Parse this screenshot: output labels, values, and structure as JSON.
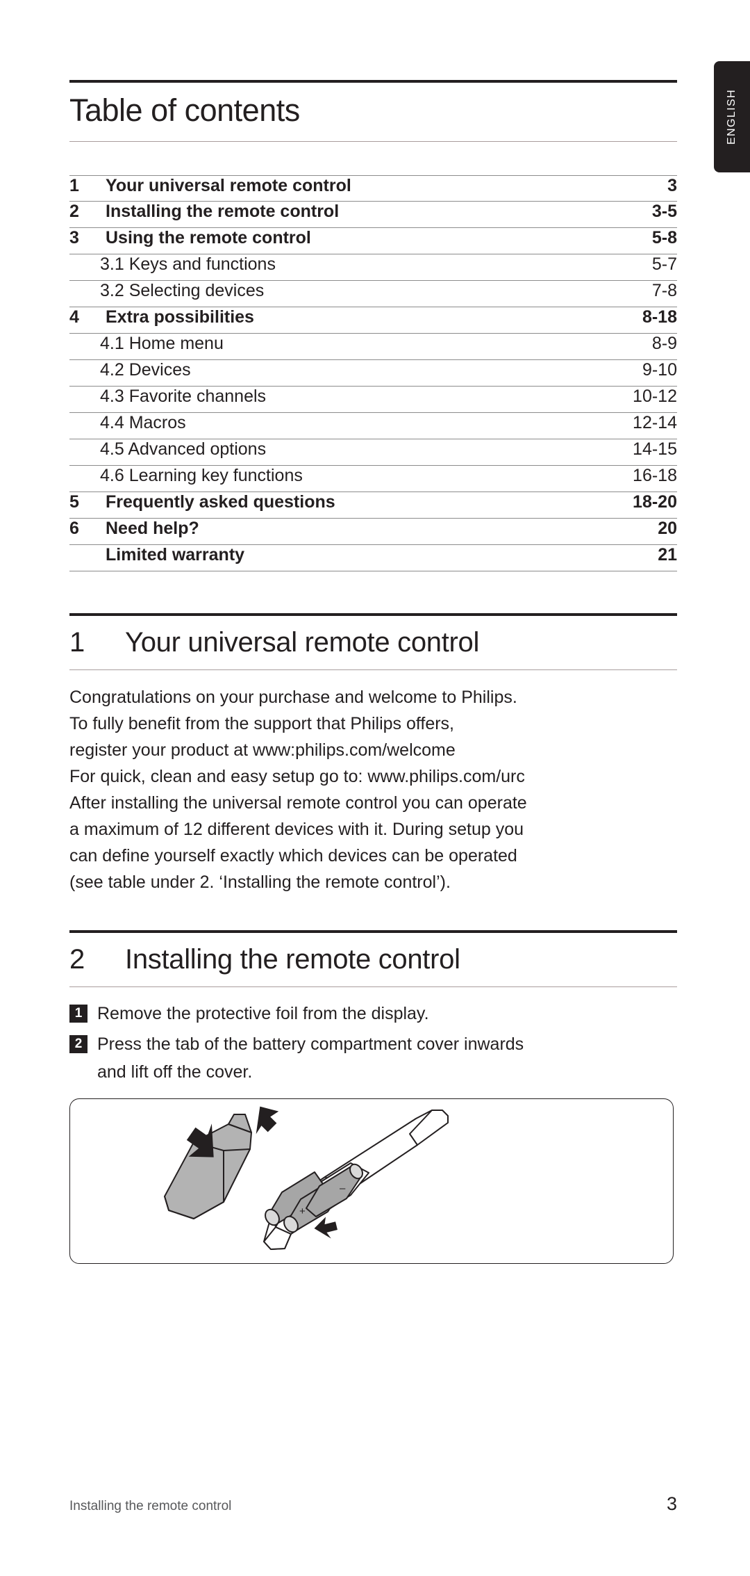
{
  "side_tab": {
    "label": "ENGLISH"
  },
  "toc": {
    "title": "Table of contents",
    "rows": [
      {
        "level": 1,
        "num": "1",
        "label": "Your universal remote control",
        "page": "3"
      },
      {
        "level": 1,
        "num": "2",
        "label": "Installing the remote control",
        "page": "3-5"
      },
      {
        "level": 1,
        "num": "3",
        "label": "Using the remote control",
        "page": "5-8"
      },
      {
        "level": 2,
        "num": "",
        "label": "3.1 Keys and functions",
        "page": "5-7"
      },
      {
        "level": 2,
        "num": "",
        "label": "3.2 Selecting devices",
        "page": "7-8"
      },
      {
        "level": 1,
        "num": "4",
        "label": "Extra possibilities",
        "page": "8-18"
      },
      {
        "level": 2,
        "num": "",
        "label": "4.1 Home menu",
        "page": "8-9"
      },
      {
        "level": 2,
        "num": "",
        "label": "4.2 Devices",
        "page": "9-10"
      },
      {
        "level": 2,
        "num": "",
        "label": "4.3 Favorite channels",
        "page": "10-12"
      },
      {
        "level": 2,
        "num": "",
        "label": "4.4 Macros",
        "page": "12-14"
      },
      {
        "level": 2,
        "num": "",
        "label": "4.5 Advanced options",
        "page": "14-15"
      },
      {
        "level": 2,
        "num": "",
        "label": "4.6 Learning key functions",
        "page": "16-18"
      },
      {
        "level": 1,
        "num": "5",
        "label": "Frequently asked questions",
        "page": "18-20"
      },
      {
        "level": 1,
        "num": "6",
        "label": "Need help?",
        "page": "20"
      },
      {
        "level": 1,
        "num": "",
        "label": "Limited warranty",
        "page": "21"
      }
    ]
  },
  "chapter1": {
    "num": "1",
    "title": "Your universal remote control",
    "lines": [
      "Congratulations on your purchase and welcome to Philips.",
      "To fully benefit from the support that Philips offers,",
      "register your product at www:philips.com/welcome",
      "For quick, clean and easy setup go to: www.philips.com/urc",
      "After installing the universal remote control you can operate",
      "a maximum of 12 different devices with it. During setup you",
      "can define yourself exactly which devices can be operated",
      "(see table under 2. ‘Installing the remote control’)."
    ]
  },
  "chapter2": {
    "num": "2",
    "title": "Installing the remote control",
    "steps": [
      {
        "badge": "1",
        "text": "Remove the protective foil from the display.",
        "cont": ""
      },
      {
        "badge": "2",
        "text": "Press the tab of the battery compartment cover inwards",
        "cont": "and lift off the cover."
      }
    ],
    "figure": {
      "name": "remote-battery-compartment-illustration",
      "body_color": "#ffffff",
      "cover_color": "#b3b3b3",
      "battery_color": "#a6a6a6",
      "outline_color": "#231f20"
    }
  },
  "footer": {
    "left": "Installing the remote control",
    "right": "3"
  }
}
